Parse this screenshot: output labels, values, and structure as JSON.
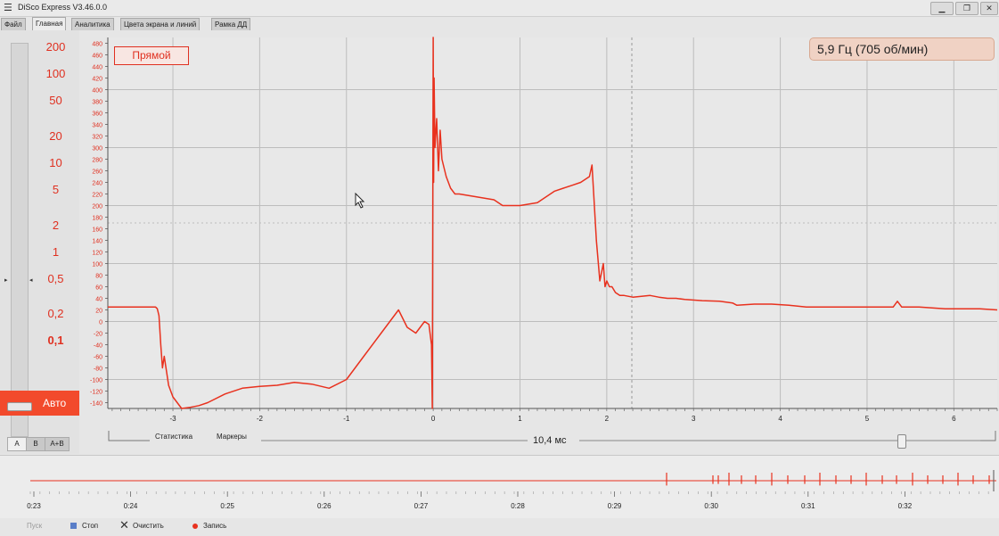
{
  "window": {
    "title": "DiSco Express V3.46.0.0",
    "icon": "menu-icon",
    "controls": [
      "minimize-icon",
      "maximize-icon",
      "close-icon"
    ]
  },
  "tabs": [
    "Файл",
    "Главная",
    "Аналитика",
    "Цвета экрана и линий",
    "Рамка ДД"
  ],
  "scale": {
    "labels": [
      "200",
      "100",
      "50",
      "20",
      "10",
      "5",
      "2",
      "1",
      "0,5",
      "0,2",
      "0,1"
    ],
    "selected": "0,1",
    "auto_label": "Авто"
  },
  "channel_tabs": [
    "A",
    "B",
    "A+B"
  ],
  "mode_label": "Прямой",
  "frequency_label": "5,9 Гц (705 об/мин)",
  "colors": {
    "trace": "#e8311e",
    "accent": "#f24a2c",
    "grid": "#b8b8b8",
    "background": "#e6e6e6"
  },
  "chart_data": {
    "type": "line",
    "title": "",
    "xlabel": "",
    "ylabel": "",
    "xlim": [
      -3.75,
      6.5
    ],
    "ylim": [
      -150,
      490
    ],
    "x_ticks": [
      "-3",
      "-2",
      "-1",
      "0",
      "1",
      "2",
      "3",
      "4",
      "5",
      "6"
    ],
    "y_ticks": [
      "480",
      "460",
      "440",
      "420",
      "400",
      "380",
      "360",
      "340",
      "320",
      "300",
      "280",
      "260",
      "240",
      "220",
      "200",
      "180",
      "160",
      "140",
      "120",
      "100",
      "80",
      "60",
      "40",
      "20",
      "0",
      "-20",
      "-40",
      "-60",
      "-80",
      "-100",
      "-120",
      "-140"
    ],
    "grid": true,
    "series": [
      {
        "color": "#e8311e",
        "x": [
          -3.75,
          -3.45,
          -3.2,
          -3.18,
          -3.16,
          -3.14,
          -3.12,
          -3.1,
          -3.05,
          -3.0,
          -2.9,
          -2.8,
          -2.7,
          -2.6,
          -2.4,
          -2.2,
          -2.0,
          -1.8,
          -1.6,
          -1.4,
          -1.2,
          -1.0,
          -0.9,
          -0.8,
          -0.6,
          -0.4,
          -0.3,
          -0.2,
          -0.1,
          -0.05,
          -0.02,
          -0.01,
          0.0,
          0.005,
          0.01,
          0.02,
          0.04,
          0.06,
          0.08,
          0.1,
          0.15,
          0.2,
          0.25,
          0.3,
          0.5,
          0.7,
          0.8,
          0.9,
          1.0,
          1.2,
          1.4,
          1.5,
          1.6,
          1.7,
          1.8,
          1.83,
          1.85,
          1.88,
          1.92,
          1.96,
          1.98,
          2.0,
          2.03,
          2.06,
          2.1,
          2.15,
          2.2,
          2.3,
          2.5,
          2.6,
          2.7,
          2.8,
          2.9,
          3.1,
          3.3,
          3.45,
          3.5,
          3.7,
          3.9,
          4.1,
          4.3,
          4.5,
          4.7,
          5.0,
          5.3,
          5.35,
          5.4,
          5.6,
          5.9,
          6.1,
          6.3,
          6.5
        ],
        "y": [
          25,
          25,
          25,
          22,
          10,
          -40,
          -80,
          -60,
          -110,
          -130,
          -150,
          -148,
          -145,
          -140,
          -125,
          -115,
          -112,
          -110,
          -105,
          -108,
          -115,
          -100,
          -80,
          -60,
          -20,
          20,
          -10,
          -20,
          0,
          -5,
          -40,
          -150,
          490,
          240,
          420,
          300,
          350,
          260,
          330,
          280,
          250,
          230,
          220,
          220,
          215,
          210,
          200,
          200,
          200,
          205,
          225,
          230,
          235,
          240,
          250,
          270,
          220,
          140,
          70,
          100,
          60,
          70,
          60,
          60,
          50,
          45,
          45,
          42,
          45,
          42,
          40,
          40,
          38,
          36,
          35,
          32,
          28,
          30,
          30,
          28,
          25,
          25,
          25,
          25,
          25,
          35,
          25,
          25,
          22,
          22,
          22,
          20
        ]
      }
    ]
  },
  "bottom": {
    "tab_statistics": "Статистика",
    "tab_markers": "Маркеры",
    "time_label": "10,4 мс"
  },
  "timeline": {
    "labels": [
      "0:23",
      "0:24",
      "0:25",
      "0:26",
      "0:27",
      "0:28",
      "0:29",
      "0:30",
      "0:31",
      "0:32"
    ]
  },
  "status": {
    "play": "Пуск",
    "stop": "Стоп",
    "clear": "Очистить",
    "record": "Запись"
  }
}
